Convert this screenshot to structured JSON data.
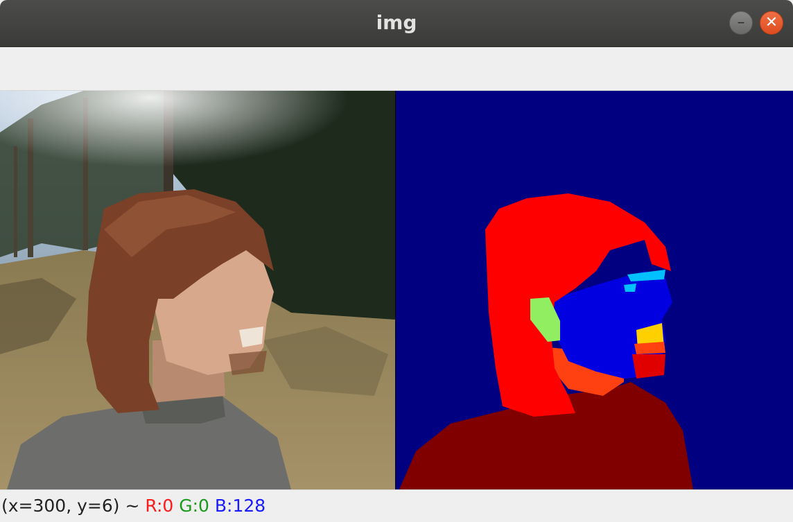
{
  "window": {
    "title": "img",
    "minimize_symbol": "–",
    "close_symbol": "✕"
  },
  "status": {
    "coords": "(x=300, y=6) ~ ",
    "r_label": "R:0",
    "g_label": "G:0",
    "b_label": "B:128",
    "r_color": "#ff1a1a",
    "g_color": "#1a9a1a",
    "b_color": "#1a1aff"
  },
  "segmentation_colors": {
    "background": "#000080",
    "hair": "#ff0000",
    "face": "#0000e0",
    "ear": "#90ee60",
    "neck": "#ff4010",
    "clothes": "#800000",
    "eyes": "#00c0ff",
    "mouth": "#ffd000"
  }
}
